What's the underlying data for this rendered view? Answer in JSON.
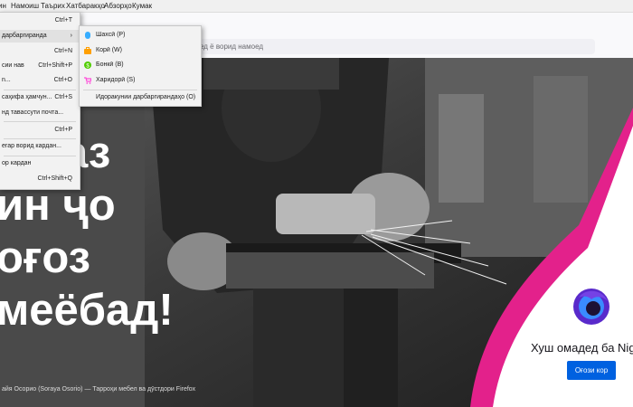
{
  "menubar": {
    "items": [
      "ин",
      "Намоиш",
      "Таърих",
      "Хатбаракҳо",
      "Абзорҳо",
      "Кумак"
    ]
  },
  "urlbar": {
    "placeholder": "ед ё ворид намоед"
  },
  "file_menu": {
    "items": [
      {
        "label": "",
        "shortcut": "Ctrl+T"
      },
      {
        "label": "дарбаргиранда",
        "shortcut": ""
      },
      {
        "label": "",
        "shortcut": "Ctrl+N"
      },
      {
        "label": "сии нав",
        "shortcut": "Ctrl+Shift+P"
      },
      {
        "label": "n...",
        "shortcut": "Ctrl+O"
      },
      {
        "label": "саҳифа ҳамчун...",
        "shortcut": "Ctrl+S"
      },
      {
        "label": "нд тавассути почта...",
        "shortcut": ""
      },
      {
        "label": "",
        "shortcut": "Ctrl+P"
      },
      {
        "label": "егар ворид кардан...",
        "shortcut": ""
      },
      {
        "label": "ор кардан",
        "shortcut": "Ctrl+Shift+Q"
      }
    ]
  },
  "container_submenu": {
    "items": [
      {
        "label": "Шахсӣ (P)",
        "icon": "fingerprint-icon",
        "color": "#37adff"
      },
      {
        "label": "Корӣ (W)",
        "icon": "briefcase-icon",
        "color": "#ff9f00"
      },
      {
        "label": "Бонкӣ (B)",
        "icon": "dollar-icon",
        "color": "#51cd00"
      },
      {
        "label": "Харидорӣ (S)",
        "icon": "cart-icon",
        "color": "#ff4bda"
      }
    ],
    "manage_label": "Идоракунии дарбаргирандаҳо (O)"
  },
  "hero": {
    "lines": [
      "ло аз",
      "ин ҷо",
      "оғоз",
      "меёбад!"
    ],
    "caption": "айя Осорио (Soraya Osorio) — Тарроҳи мебел ва дӯстдори Firefox"
  },
  "welcome": {
    "title": "Хуш омадед ба Nig",
    "button_label": "Оғози кор"
  },
  "colors": {
    "accent_blue": "#0061e0",
    "pink": "#e3218b",
    "logo_purple": "#592acb",
    "logo_blue": "#3a8bff"
  }
}
